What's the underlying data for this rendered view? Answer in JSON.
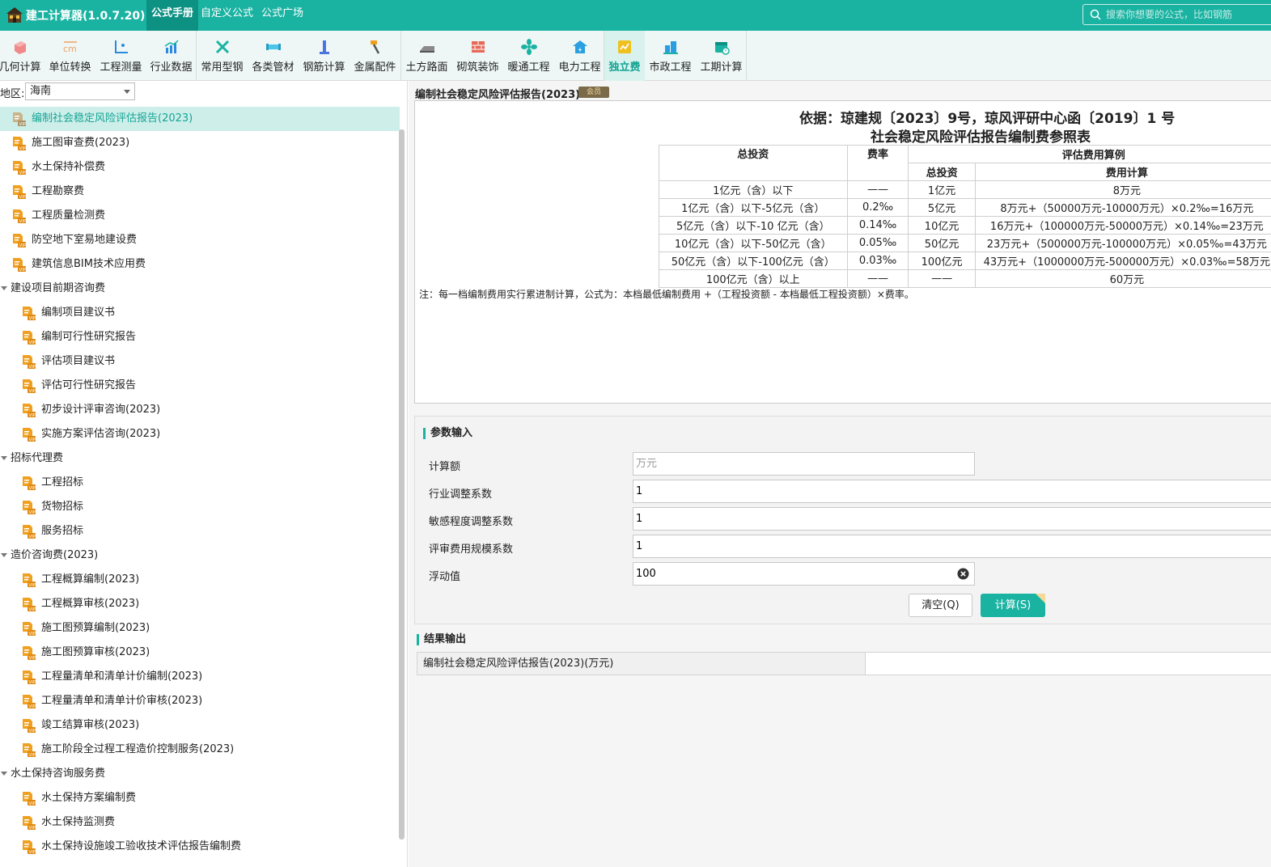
{
  "app": {
    "title": "建工计算器(1.0.7.20)"
  },
  "top_tabs": [
    {
      "label": "公式手册"
    },
    {
      "label": "自定义公式"
    },
    {
      "label": "公式广场"
    }
  ],
  "search": {
    "placeholder": "搜索你想要的公式，比如钢筋"
  },
  "toolbar": {
    "tools": [
      {
        "label": "几何计算",
        "icon": "geometry-icon"
      },
      {
        "label": "单位转换",
        "icon": "unit-convert-icon"
      },
      {
        "label": "工程测量",
        "icon": "survey-icon"
      },
      {
        "label": "行业数据",
        "icon": "industry-data-icon"
      },
      {
        "label": "常用型钢",
        "icon": "steel-section-icon"
      },
      {
        "label": "各类管材",
        "icon": "pipe-icon"
      },
      {
        "label": "钢筋计算",
        "icon": "rebar-icon"
      },
      {
        "label": "金属配件",
        "icon": "metal-fitting-icon"
      },
      {
        "label": "土方路面",
        "icon": "earthwork-icon"
      },
      {
        "label": "砌筑装饰",
        "icon": "masonry-icon"
      },
      {
        "label": "暖通工程",
        "icon": "hvac-icon"
      },
      {
        "label": "电力工程",
        "icon": "power-icon"
      },
      {
        "label": "独立费",
        "icon": "independent-fee-icon"
      },
      {
        "label": "市政工程",
        "icon": "municipal-icon"
      },
      {
        "label": "工期计算",
        "icon": "schedule-icon"
      }
    ]
  },
  "region": {
    "label": "地区:",
    "value": "海南"
  },
  "tree": [
    {
      "label": "编制社会稳定风险评估报告(2023)",
      "level": 1,
      "type": "vip",
      "selected": true
    },
    {
      "label": "施工图审查费(2023)",
      "level": 1,
      "type": "vip"
    },
    {
      "label": "水土保持补偿费",
      "level": 1,
      "type": "vip"
    },
    {
      "label": "工程勘察费",
      "level": 1,
      "type": "vip"
    },
    {
      "label": "工程质量检测费",
      "level": 1,
      "type": "vip"
    },
    {
      "label": "防空地下室易地建设费",
      "level": 1,
      "type": "vip"
    },
    {
      "label": "建筑信息BIM技术应用费",
      "level": 1,
      "type": "vip"
    },
    {
      "label": "建设项目前期咨询费",
      "level": 0,
      "type": "group"
    },
    {
      "label": "编制项目建议书",
      "level": 2,
      "type": "vip"
    },
    {
      "label": "编制可行性研究报告",
      "level": 2,
      "type": "vip"
    },
    {
      "label": "评估项目建议书",
      "level": 2,
      "type": "vip"
    },
    {
      "label": "评估可行性研究报告",
      "level": 2,
      "type": "vip"
    },
    {
      "label": "初步设计评审咨询(2023)",
      "level": 2,
      "type": "vip"
    },
    {
      "label": "实施方案评估咨询(2023)",
      "level": 2,
      "type": "vip"
    },
    {
      "label": "招标代理费",
      "level": 0,
      "type": "group"
    },
    {
      "label": "工程招标",
      "level": 2,
      "type": "vip"
    },
    {
      "label": "货物招标",
      "level": 2,
      "type": "vip"
    },
    {
      "label": "服务招标",
      "level": 2,
      "type": "vip"
    },
    {
      "label": "造价咨询费(2023)",
      "level": 0,
      "type": "group"
    },
    {
      "label": "工程概算编制(2023)",
      "level": 2,
      "type": "vip"
    },
    {
      "label": "工程概算审核(2023)",
      "level": 2,
      "type": "vip"
    },
    {
      "label": "施工图预算编制(2023)",
      "level": 2,
      "type": "vip"
    },
    {
      "label": "施工图预算审核(2023)",
      "level": 2,
      "type": "vip"
    },
    {
      "label": "工程量清单和清单计价编制(2023)",
      "level": 2,
      "type": "vip"
    },
    {
      "label": "工程量清单和清单计价审核(2023)",
      "level": 2,
      "type": "vip"
    },
    {
      "label": "竣工结算审核(2023)",
      "level": 2,
      "type": "vip"
    },
    {
      "label": "施工阶段全过程工程造价控制服务(2023)",
      "level": 2,
      "type": "vip"
    },
    {
      "label": "水土保持咨询服务费",
      "level": 0,
      "type": "group"
    },
    {
      "label": "水土保持方案编制费",
      "level": 2,
      "type": "vip"
    },
    {
      "label": "水土保持监测费",
      "level": 2,
      "type": "vip"
    },
    {
      "label": "水土保持设施竣工验收技术评估报告编制费",
      "level": 2,
      "type": "vip"
    }
  ],
  "doc": {
    "title": "编制社会稳定风险评估报告(2023)",
    "badge": "会员",
    "heading1": "依据：琼建规〔2023〕9号，琼风评研中心函〔2019〕1 号",
    "heading2": "社会稳定风险评估报告编制费参照表",
    "table": {
      "headers": {
        "total": "总投资",
        "rate": "费率",
        "example": "评估费用算例",
        "ex_total": "总投资",
        "ex_calc": "费用计算"
      },
      "rows": [
        {
          "range": "1亿元（含）以下",
          "rate": "——",
          "ex_total": "1亿元",
          "calc": "8万元"
        },
        {
          "range": "1亿元（含）以下-5亿元（含）",
          "rate": "0.2‰",
          "ex_total": "5亿元",
          "calc": "8万元+（50000万元-10000万元）×0.2‰=16万元"
        },
        {
          "range": "5亿元（含）以下-10 亿元（含）",
          "rate": "0.14‰",
          "ex_total": "10亿元",
          "calc": "16万元+（100000万元-50000万元）×0.14‰=23万元"
        },
        {
          "range": "10亿元（含）以下-50亿元（含）",
          "rate": "0.05‰",
          "ex_total": "50亿元",
          "calc": "23万元+（500000万元-100000万元）×0.05‰=43万元"
        },
        {
          "range": "50亿元（含）以下-100亿元（含）",
          "rate": "0.03‰",
          "ex_total": "100亿元",
          "calc": "43万元+（1000000万元-500000万元）×0.03‰=58万元"
        },
        {
          "range": "100亿元（含）以上",
          "rate": "——",
          "ex_total": "——",
          "calc": "60万元"
        }
      ]
    },
    "note": "注：每一档编制费用实行累进制计算，公式为：本档最低编制费用 +（工程投资额 - 本档最低工程投资额）×费率。"
  },
  "params": {
    "section_title": "参数输入",
    "fields": [
      {
        "label": "计算额",
        "value": "",
        "placeholder": "万元"
      },
      {
        "label": "行业调整系数",
        "value": "1",
        "placeholder": ""
      },
      {
        "label": "敏感程度调整系数",
        "value": "1",
        "placeholder": ""
      },
      {
        "label": "评审费用规模系数",
        "value": "1",
        "placeholder": ""
      },
      {
        "label": "浮动值",
        "value": "100",
        "placeholder": ""
      }
    ],
    "clear_label": "清空(Q)",
    "calc_label": "计算(S)"
  },
  "result": {
    "section_title": "结果输出",
    "label": "编制社会稳定风险评估报告(2023)(万元)",
    "value": ""
  },
  "colors": {
    "brand": "#1ab3a2",
    "brand_dark": "#0c9183",
    "selected_bg": "#cdeee9",
    "vip": "#f0a020"
  }
}
